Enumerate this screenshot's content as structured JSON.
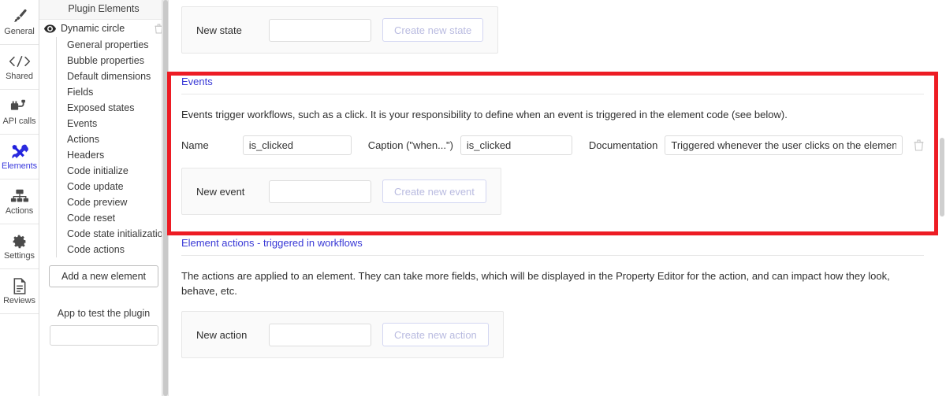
{
  "rail": {
    "items": [
      {
        "label": "General",
        "icon": "brush-icon",
        "active": false
      },
      {
        "label": "Shared",
        "icon": "code-icon",
        "active": false
      },
      {
        "label": "API calls",
        "icon": "api-plug-icon",
        "active": false
      },
      {
        "label": "Elements",
        "icon": "tools-icon",
        "active": true
      },
      {
        "label": "Actions",
        "icon": "sitemap-icon",
        "active": false
      },
      {
        "label": "Settings",
        "icon": "gear-icon",
        "active": false
      },
      {
        "label": "Reviews",
        "icon": "document-icon",
        "active": false
      }
    ],
    "active_color": "#3b3bdd"
  },
  "sidebar": {
    "title": "Plugin Elements",
    "root": {
      "label": "Dynamic circle",
      "eye_icon": "eye-icon",
      "delete_icon": "trash-icon"
    },
    "children": [
      "General properties",
      "Bubble properties",
      "Default dimensions",
      "Fields",
      "Exposed states",
      "Events",
      "Actions",
      "Headers",
      "Code initialize",
      "Code update",
      "Code preview",
      "Code reset",
      "Code state initialization",
      "Code actions"
    ],
    "add_element_button": "Add a new element",
    "app_to_test_label": "App to test the plugin",
    "app_to_test_value": "",
    "app_to_test_placeholder": ""
  },
  "main": {
    "new_state_panel": {
      "label": "New state",
      "input_value": "",
      "input_placeholder": "",
      "button_label": "Create new state"
    },
    "events_section": {
      "heading": "Events",
      "description": "Events trigger workflows, such as a click. It is your responsibility to define when an event is triggered in the element code (see below).",
      "rows": [
        {
          "name_label": "Name",
          "name_value": "is_clicked",
          "caption_label": "Caption (\"when...\")",
          "caption_value": "is_clicked",
          "documentation_label": "Documentation",
          "documentation_value": "Triggered whenever the user clicks on the element",
          "delete_icon": "trash-icon"
        }
      ],
      "new_event_panel": {
        "label": "New event",
        "input_value": "",
        "input_placeholder": "",
        "button_label": "Create new event"
      },
      "highlight_color": "#ed1c24"
    },
    "element_actions_section": {
      "heading": "Element actions - triggered in workflows",
      "description": "The actions are applied to an element. They can take more fields, which will be displayed in the Property Editor for the action, and can impact how they look, behave, etc.",
      "new_action_panel": {
        "label": "New action",
        "input_value": "",
        "input_placeholder": "",
        "button_label": "Create new action"
      }
    },
    "link_color": "#3838d6"
  }
}
